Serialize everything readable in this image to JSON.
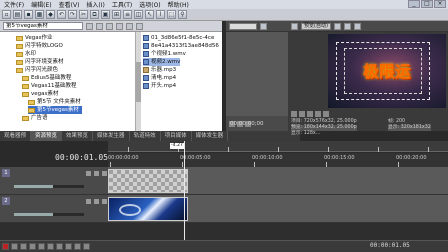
{
  "menu": {
    "items": [
      "文件(F)",
      "编辑(E)",
      "查看(V)",
      "插入(I)",
      "工具(T)",
      "选项(O)",
      "帮助(H)"
    ]
  },
  "explorer": {
    "path": "第5节vegas素材",
    "tree": [
      {
        "label": "Vegas作业"
      },
      {
        "label": "闪字特效LOGO"
      },
      {
        "label": "水印"
      },
      {
        "label": "闪字环境变素材"
      },
      {
        "label": "闪字闪光颜色"
      },
      {
        "label": "Edius5基础教程"
      },
      {
        "label": "Vegas11基础教程"
      },
      {
        "label": "vegas素材"
      },
      {
        "label": "第5节 文件夹素材"
      },
      {
        "label": "第5节vegas素材"
      },
      {
        "label": "广告语"
      }
    ],
    "files": [
      {
        "label": "01_3d86e5f1-8e5c-4ce",
        "type": "video"
      },
      {
        "label": "8e41a4313f13ae848d56",
        "type": "video"
      },
      {
        "label": "个视频1.wmv",
        "type": "video"
      },
      {
        "label": "视频2.wmv",
        "type": "video"
      },
      {
        "label": "乐器.mp3",
        "type": "audio"
      },
      {
        "label": "清电.mp4",
        "type": "video"
      },
      {
        "label": "开头.mp4",
        "type": "video"
      }
    ]
  },
  "tabs": [
    "观看器预",
    "资源预览",
    "效果预览",
    "媒体发生器",
    "轨道特效",
    "项目媒体",
    "媒体发生器"
  ],
  "trimmer": {
    "time": "00:00:00;00"
  },
  "preview": {
    "mode": "预览(自动)",
    "title_text": "极限运",
    "info_left": [
      "项目: 720x576x32, 25.000p",
      "预览: 180x144x32, 25.000p",
      "显示: 128x... "
    ],
    "info_right": [
      "帧: 200",
      "显示: 320x181x32"
    ]
  },
  "timeline": {
    "timecode": "00:00:01.05",
    "marker": "-4.27",
    "ruler_labels": [
      "00:00:00:00",
      "00:00:05:00",
      "00:00:10:00",
      "00:00:15:00",
      "00:00:20:00"
    ],
    "tracks": [
      {
        "num": "1",
        "level": 0.55
      },
      {
        "num": "2",
        "level": 0.55
      }
    ],
    "status_time": "00:00:01.05"
  }
}
